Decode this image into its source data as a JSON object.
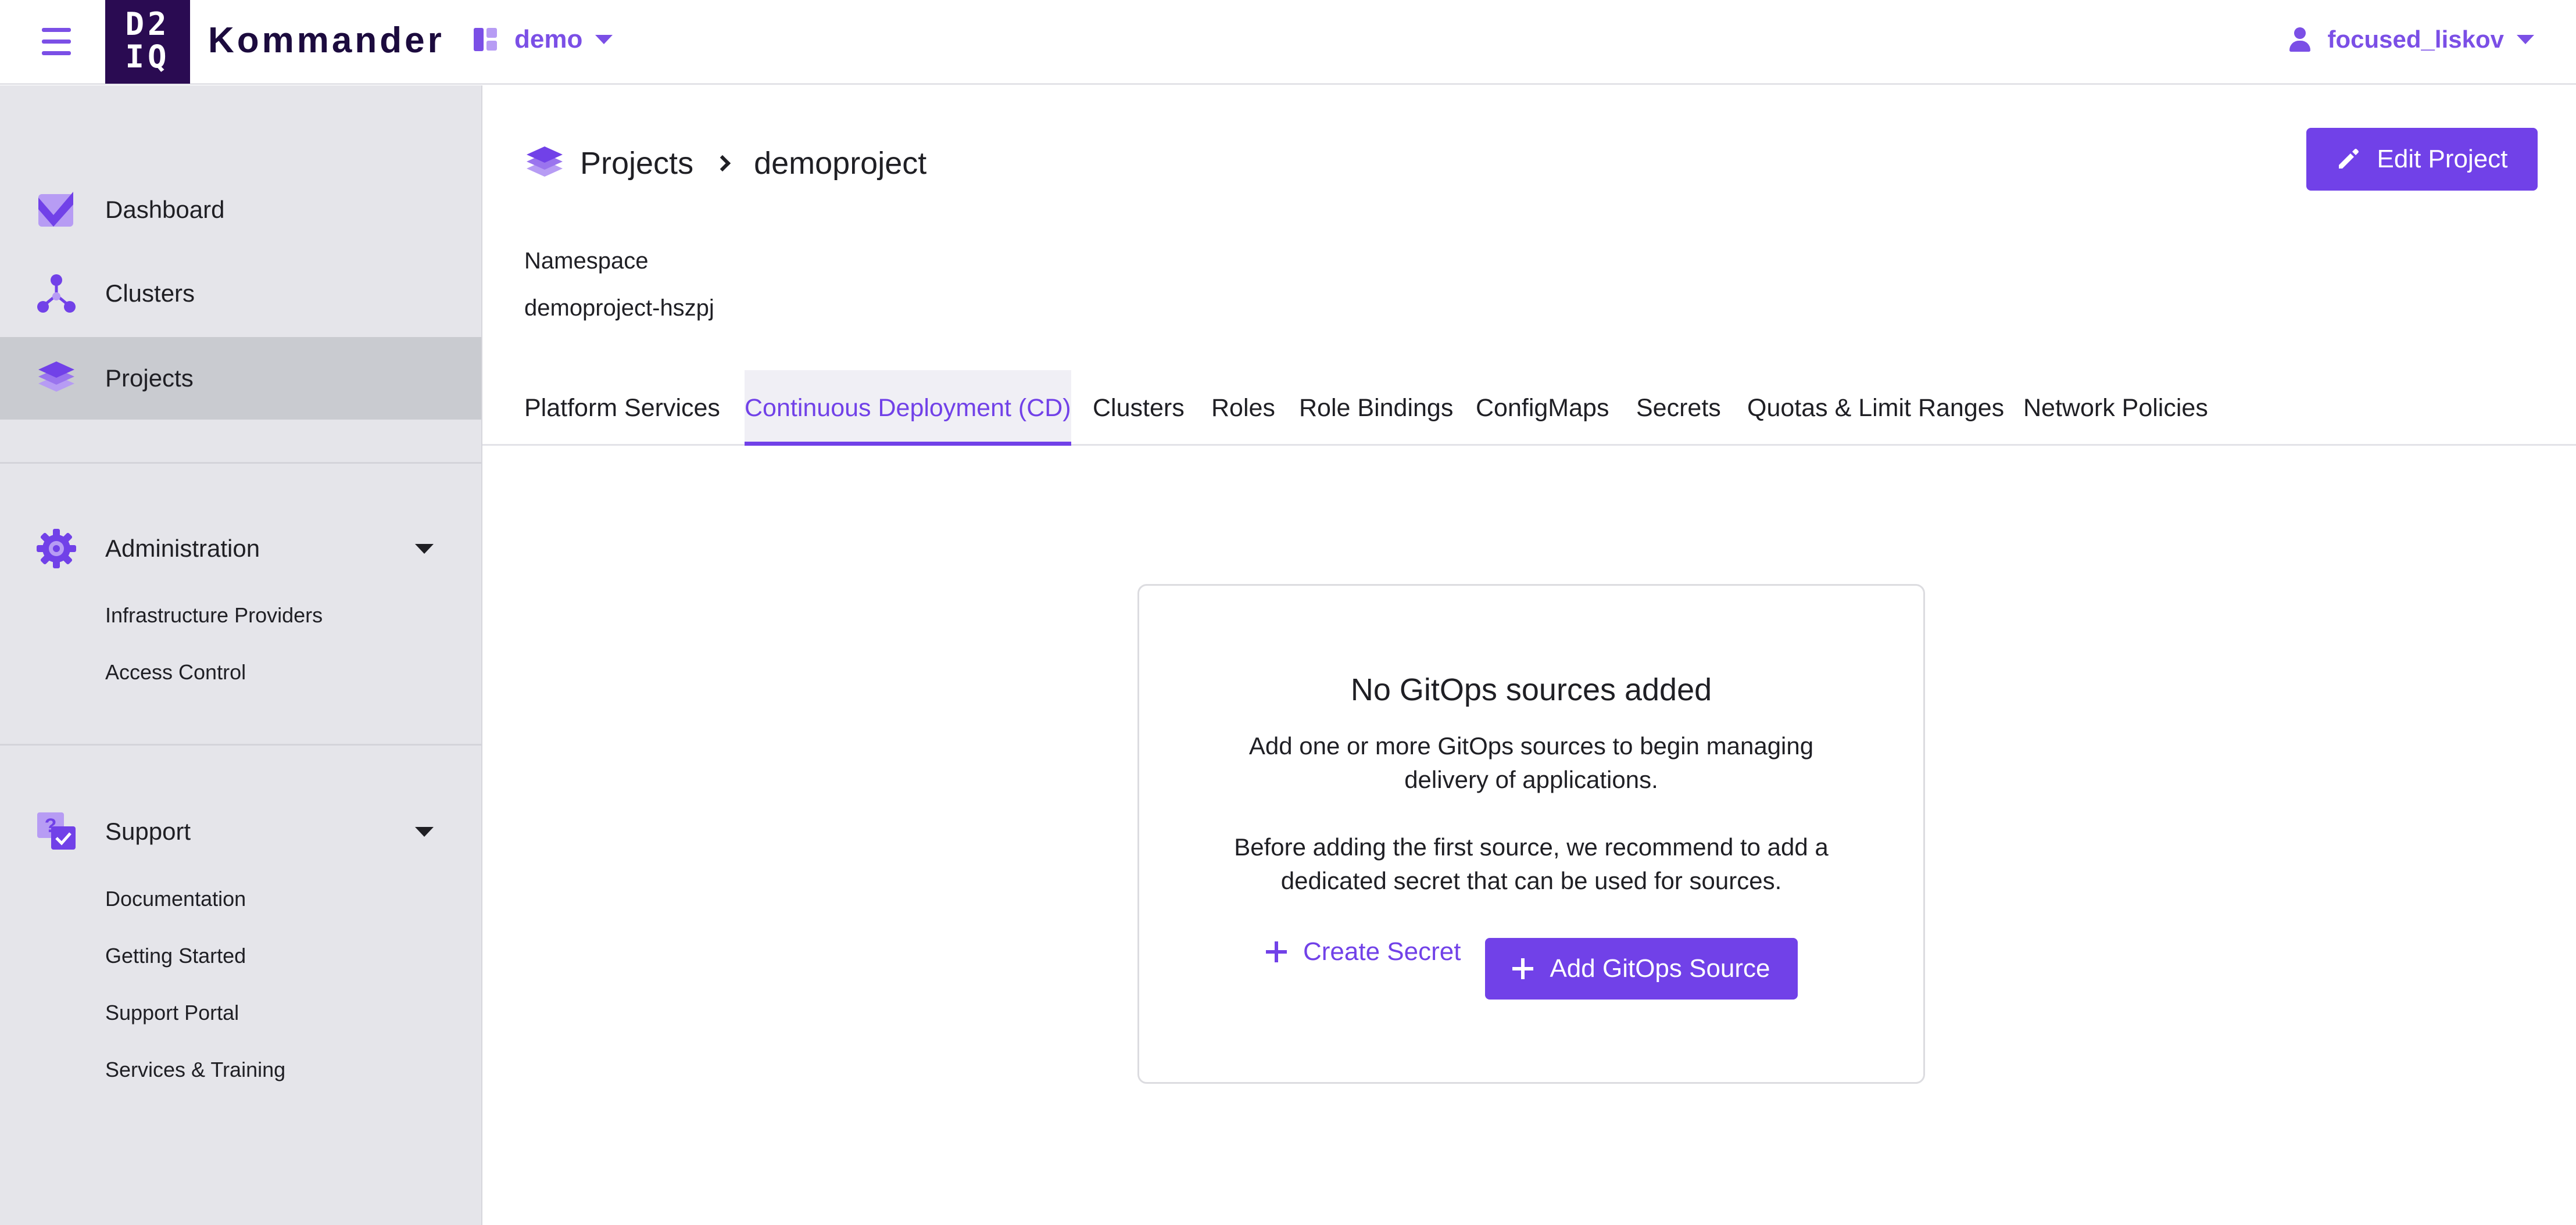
{
  "header": {
    "logo_text_line1": "D2",
    "logo_text_line2": "IQ",
    "brand": "Kommander",
    "workspace": "demo",
    "user": "focused_liskov",
    "accent_color": "#7141e8"
  },
  "sidebar": {
    "items": [
      {
        "label": "Dashboard",
        "icon": "dashboard-icon"
      },
      {
        "label": "Clusters",
        "icon": "clusters-icon"
      },
      {
        "label": "Projects",
        "icon": "projects-icon",
        "active": true
      }
    ],
    "administration": {
      "label": "Administration",
      "icon": "gear-icon",
      "items": [
        "Infrastructure Providers",
        "Access Control"
      ]
    },
    "support": {
      "label": "Support",
      "icon": "support-icon",
      "items": [
        "Documentation",
        "Getting Started",
        "Support Portal",
        "Services & Training"
      ]
    }
  },
  "breadcrumb": {
    "parent": "Projects",
    "current": "demoproject"
  },
  "edit_button": "Edit Project",
  "namespace": {
    "label": "Namespace",
    "value": "demoproject-hszpj"
  },
  "tabs": [
    "Platform Services",
    "Continuous Deployment (CD)",
    "Clusters",
    "Roles",
    "Role Bindings",
    "ConfigMaps",
    "Secrets",
    "Quotas & Limit Ranges",
    "Network Policies"
  ],
  "active_tab": "Continuous Deployment (CD)",
  "empty_state": {
    "title": "No GitOps sources added",
    "desc1_line1": "Add one or more GitOps sources to begin managing",
    "desc1_line2": "delivery of applications.",
    "desc2_line1": "Before adding the first source, we recommend to add a",
    "desc2_line2": "dedicated secret that can be used for sources.",
    "secondary_button": "Create Secret",
    "primary_button": "Add GitOps Source"
  }
}
